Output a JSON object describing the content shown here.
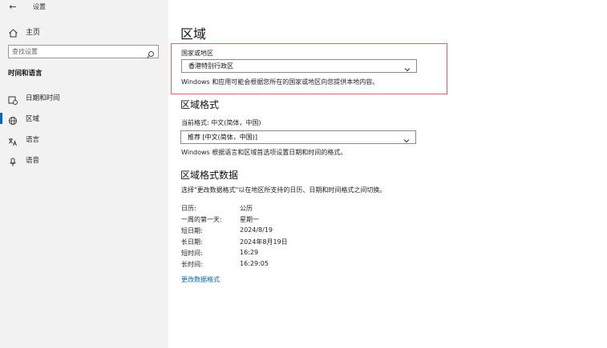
{
  "window": {
    "back": "←",
    "title": "设置"
  },
  "sidebar": {
    "home_label": "主页",
    "search_placeholder": "查找设置",
    "section_title": "时间和语言",
    "items": [
      {
        "label": "日期和时间",
        "icon": "calendar-clock-icon",
        "active": false
      },
      {
        "label": "区域",
        "icon": "globe-icon",
        "active": true
      },
      {
        "label": "语言",
        "icon": "language-icon",
        "active": false
      },
      {
        "label": "语音",
        "icon": "microphone-icon",
        "active": false
      }
    ]
  },
  "main": {
    "title": "区域",
    "country": {
      "label": "国家或地区",
      "value": "香港特别行政区",
      "description": "Windows 和应用可能会根据您所在的国家或地区向您提供本地内容。"
    },
    "format": {
      "heading": "区域格式",
      "current_label": "当前格式: 中文(简体，中国)",
      "value": "推荐 [中文(简体，中国)]",
      "description": "Windows 根据语言和区域首选项设置日期和时间的格式。"
    },
    "format_data": {
      "heading": "区域格式数据",
      "description": "选择\"更改数据格式\"以在地区所支持的日历、日期和时间格式之间切换。",
      "rows": [
        {
          "key": "日历:",
          "value": "公历"
        },
        {
          "key": "一周的第一天:",
          "value": "星期一"
        },
        {
          "key": "短日期:",
          "value": "2024/8/19"
        },
        {
          "key": "长日期:",
          "value": "2024年8月19日"
        },
        {
          "key": "短时间:",
          "value": "16:29"
        },
        {
          "key": "长时间:",
          "value": "16:29:05"
        }
      ],
      "link": "更改数据格式"
    }
  },
  "colors": {
    "accent": "#0067c0",
    "highlight_border": "#e06070",
    "sidebar_bg": "#f2f2f2"
  }
}
